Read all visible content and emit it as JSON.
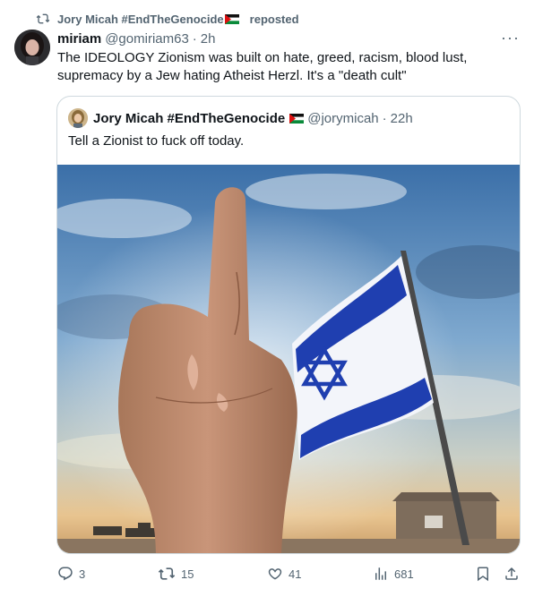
{
  "repost": {
    "reposter_name": "Jory Micah #EndTheGenocide",
    "label": "reposted"
  },
  "tweet": {
    "author_name": "miriam",
    "author_handle": "@gomiriam63",
    "separator": "·",
    "time": "2h",
    "more_label": "···",
    "text": "The IDEOLOGY Zionism was built on hate, greed, racism, blood lust, supremacy by a Jew hating Atheist Herzl. It's a \"death cult\""
  },
  "quote": {
    "author_name": "Jory Micah #EndTheGenocide",
    "author_handle": "@jorymicah",
    "separator": "·",
    "time": "22h",
    "text": "Tell a Zionist to fuck off today."
  },
  "actions": {
    "replies": "3",
    "reposts": "15",
    "likes": "41",
    "views": "681"
  },
  "colors": {
    "secondary_text": "#536471",
    "primary_text": "#0f1419",
    "border": "#cfd9de",
    "flag_blue": "#1f3fb0"
  },
  "icons": {
    "repost": "repost-icon",
    "more": "more-icon",
    "reply": "reply-icon",
    "like": "like-icon",
    "views": "views-icon",
    "bookmark": "bookmark-icon",
    "share": "share-icon"
  }
}
